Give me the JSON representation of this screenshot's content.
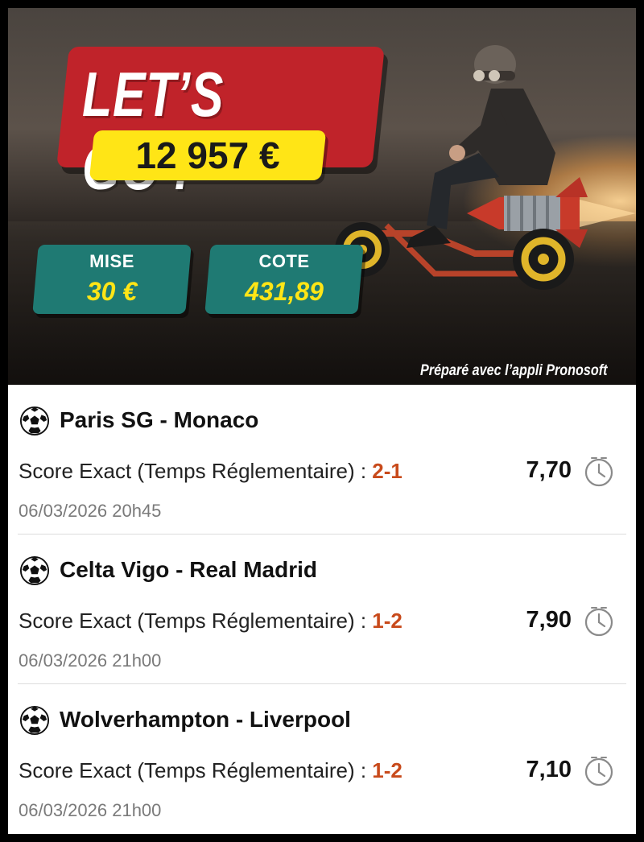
{
  "banner": {
    "title": "LET’S GO !",
    "amount": "12 957 €",
    "stake_label": "MISE",
    "stake_value": "30 €",
    "odds_label": "COTE",
    "odds_value": "431,89",
    "credit": "Préparé avec l’appli Pronosoft",
    "colors": {
      "title_bg": "#c0232a",
      "amount_bg": "#ffe516",
      "stat_bg": "#1f7a73",
      "stat_value": "#ffe516"
    }
  },
  "bets": [
    {
      "match": "Paris SG - Monaco",
      "market": "Score Exact (Temps Réglementaire) : ",
      "score": "2-1",
      "odds": "7,70",
      "date": "06/03/2026 20h45",
      "icon": "soccer-ball-icon",
      "status_icon": "clock-icon"
    },
    {
      "match": "Celta Vigo - Real Madrid",
      "market": "Score Exact (Temps Réglementaire) : ",
      "score": "1-2",
      "odds": "7,90",
      "date": "06/03/2026 21h00",
      "icon": "soccer-ball-icon",
      "status_icon": "clock-icon"
    },
    {
      "match": "Wolverhampton - Liverpool",
      "market": "Score Exact (Temps Réglementaire) : ",
      "score": "1-2",
      "odds": "7,10",
      "date": "06/03/2026 21h00",
      "icon": "soccer-ball-icon",
      "status_icon": "clock-icon"
    }
  ],
  "colors": {
    "score": "#c84a1b",
    "date": "#7a7a7a"
  }
}
